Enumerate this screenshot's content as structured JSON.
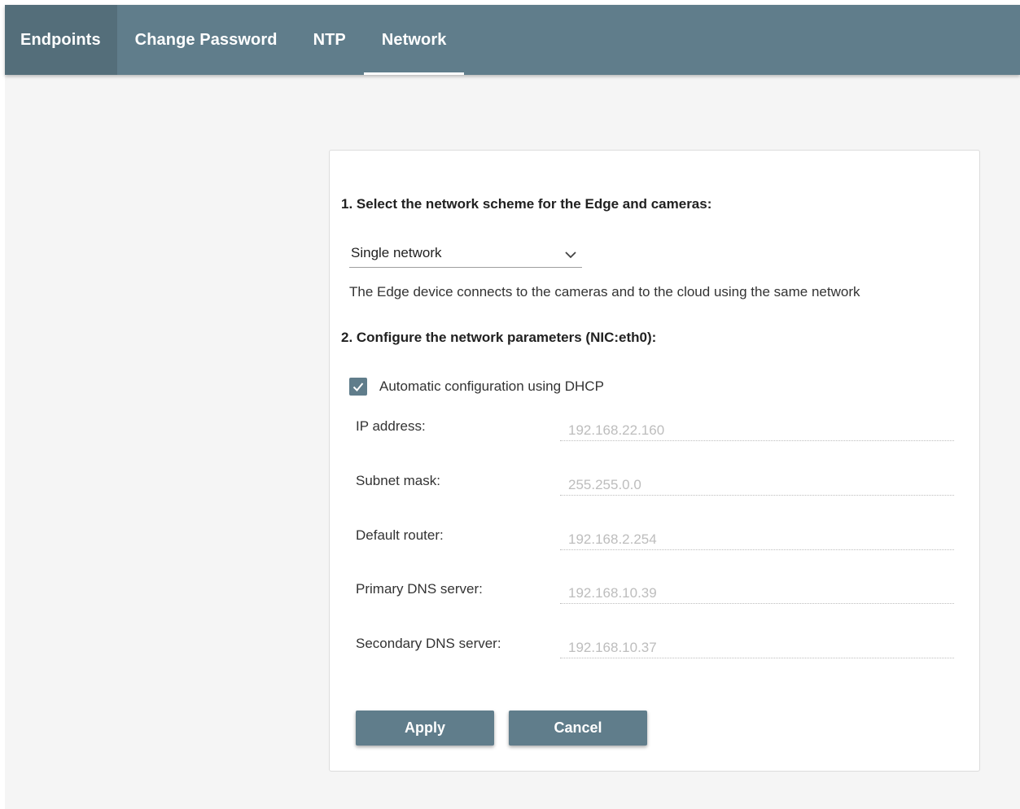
{
  "nav": {
    "tabs": [
      {
        "label": "Endpoints"
      },
      {
        "label": "Change Password"
      },
      {
        "label": "NTP"
      },
      {
        "label": "Network"
      }
    ],
    "active_tab": "Network"
  },
  "network": {
    "step1_title": "1. Select the network scheme for the Edge and cameras:",
    "scheme_selected": "Single network",
    "scheme_description": "The Edge device connects to the cameras and to the cloud using the same network",
    "step2_title": "2. Configure the network parameters (NIC:eth0):",
    "dhcp_label": "Automatic configuration using DHCP",
    "dhcp_checked": true,
    "fields": [
      {
        "label": "IP address:",
        "value": "192.168.22.160"
      },
      {
        "label": "Subnet mask:",
        "value": "255.255.0.0"
      },
      {
        "label": "Default router:",
        "value": "192.168.2.254"
      },
      {
        "label": "Primary DNS server:",
        "value": "192.168.10.39"
      },
      {
        "label": "Secondary DNS server:",
        "value": "192.168.10.37"
      }
    ],
    "apply_label": "Apply",
    "cancel_label": "Cancel"
  },
  "colors": {
    "nav_bg": "#607d8b",
    "nav_first_tab_bg": "#546e7a",
    "accent": "#607d8b",
    "page_bg": "#f5f5f5",
    "disabled_text": "#bdbdbd"
  },
  "icons": {
    "select_chevron": "chevron-down-icon",
    "checkbox": "checkmark-icon"
  }
}
